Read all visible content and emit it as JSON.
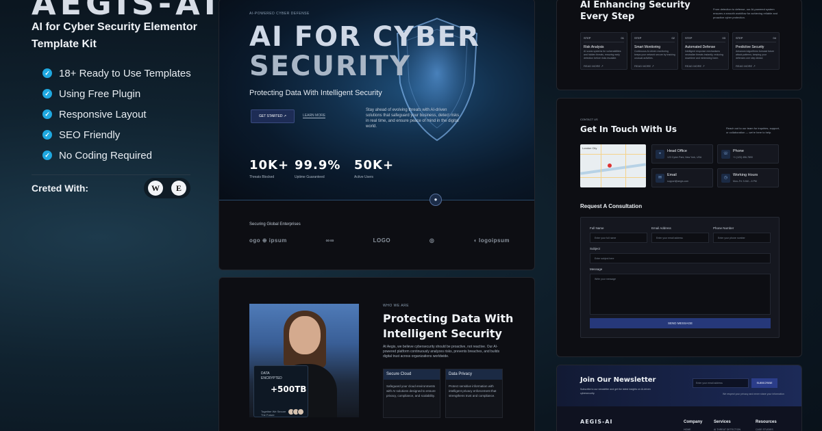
{
  "left": {
    "brand": "AEGIS-AI",
    "kit_title": "AI for Cyber Security Elementor Template Kit",
    "features": [
      "18+ Ready to Use Templates",
      "Using Free Plugin",
      "Responsive Layout",
      "SEO Friendly",
      "No Coding Required"
    ],
    "created_label": "Creted With:",
    "plugin_icons": [
      "wordpress-icon",
      "elementor-icon"
    ]
  },
  "hero": {
    "tag": "AI-POWERED CYBER DEFENSE",
    "title_line1": "AI FOR CYBER",
    "title_line2": "SECURITY",
    "subtitle": "Protecting Data With Intelligent Security",
    "btn_start": "GET STARTED ↗",
    "btn_learn": "LEARN MORE",
    "description": "Stay ahead of evolving threats with AI-driven solutions that safeguard your business, detect risks in real time, and ensure peace of mind in the digital world.",
    "stats": [
      {
        "value": "10K+",
        "label": "Threats Blocked"
      },
      {
        "value": "99.9%",
        "label": "Uptime Guaranteed"
      },
      {
        "value": "50K+",
        "label": "Active Users"
      }
    ],
    "logos_title": "Securing Global Enterprises",
    "logos": [
      "ogo ⊕ ipsum",
      "∞∞",
      "LOGO",
      "◎",
      "◖ logoipsum"
    ]
  },
  "about": {
    "tag": "WHO WE ARE",
    "heading": "Protecting Data With Intelligent Security",
    "paragraph": "At Aegis, we believe cybersecurity should be proactive, not reactive. Our AI-powered platform continuously analyzes risks, prevents breaches, and builds digital trust across organizations worldwide.",
    "card_title": "DATA ENCRYPTED",
    "card_value": "+500TB",
    "card_caption": "Together We Secure The Future",
    "features": [
      {
        "title": "Secure Cloud",
        "text": "Safeguard your cloud environments with AI solutions designed to ensure privacy, compliance, and scalability."
      },
      {
        "title": "Data Privacy",
        "text": "Protect sensitive information with intelligent privacy enforcement that strengthens trust and compliance."
      }
    ]
  },
  "steps": {
    "heading_line1": "AI Enhancing Security",
    "heading_line2": "Every Step",
    "description": "From detection to defense, our AI-powered system ensures a smooth workflow for achieving reliable and proactive cyber protection.",
    "items": [
      {
        "step": "STEP",
        "num": "01",
        "title": "Risk Analysis",
        "text": "AI scans systems for vulnerabilities and hidden threats, ensuring early detection before risks escalate.",
        "more": "READ MORE ↗"
      },
      {
        "step": "STEP",
        "num": "02",
        "title": "Smart Monitoring",
        "text": "Continuous AI-driven monitoring keeps your network secure by tracking unusual activities.",
        "more": "READ MORE ↗"
      },
      {
        "step": "STEP",
        "num": "03",
        "title": "Automated Defense",
        "text": "Intelligent response mechanisms neutralize threats instantly, reducing downtime and minimizing harm.",
        "more": "READ MORE ↗"
      },
      {
        "step": "STEP",
        "num": "04",
        "title": "Predictive Security",
        "text": "Advanced algorithms forecast future attack patterns, keeping your defenses one step ahead.",
        "more": "READ MORE ↗"
      }
    ]
  },
  "contact": {
    "tag": "CONTACT US",
    "heading": "Get In Touch With Us",
    "description": "Reach out to our team for inquiries, support, or collaboration — we're here to help.",
    "map_label": "London City",
    "info": [
      {
        "icon": "location-icon",
        "title": "Head Office",
        "sub": "123 Cyber Park, New York, USA"
      },
      {
        "icon": "phone-icon",
        "title": "Phone",
        "sub": "+1 (123) 456-7890"
      },
      {
        "icon": "mail-icon",
        "title": "Email",
        "sub": "support@aegis.com"
      },
      {
        "icon": "clock-icon",
        "title": "Working Hours",
        "sub": "Mon–Fri: 9 AM – 6 PM"
      }
    ],
    "form_heading": "Request A Consultation",
    "labels": {
      "name": "Full Name",
      "email": "Email Address",
      "phone": "Phone Number",
      "subject": "Subject",
      "message": "Message"
    },
    "placeholders": {
      "name": "Enter your full name",
      "email": "Enter your email address",
      "phone": "Enter your phone number",
      "subject": "Enter subject here",
      "message": "Write your message"
    },
    "send": "SEND MESSAGE"
  },
  "newsletter": {
    "heading": "Join Our Newsletter",
    "description": "Subscribe to our newsletter and get the latest insights on AI-driven cybersecurity.",
    "placeholder": "Enter your email address",
    "button": "SUBSCRIBE",
    "note": "We respect your privacy and never share your information",
    "footer_brand": "AEGIS-AI",
    "cols": [
      {
        "title": "Company",
        "sub": "HOME"
      },
      {
        "title": "Services",
        "sub": "AI THREAT DETECTION"
      },
      {
        "title": "Resources",
        "sub": "CASE STUDIES"
      }
    ]
  }
}
